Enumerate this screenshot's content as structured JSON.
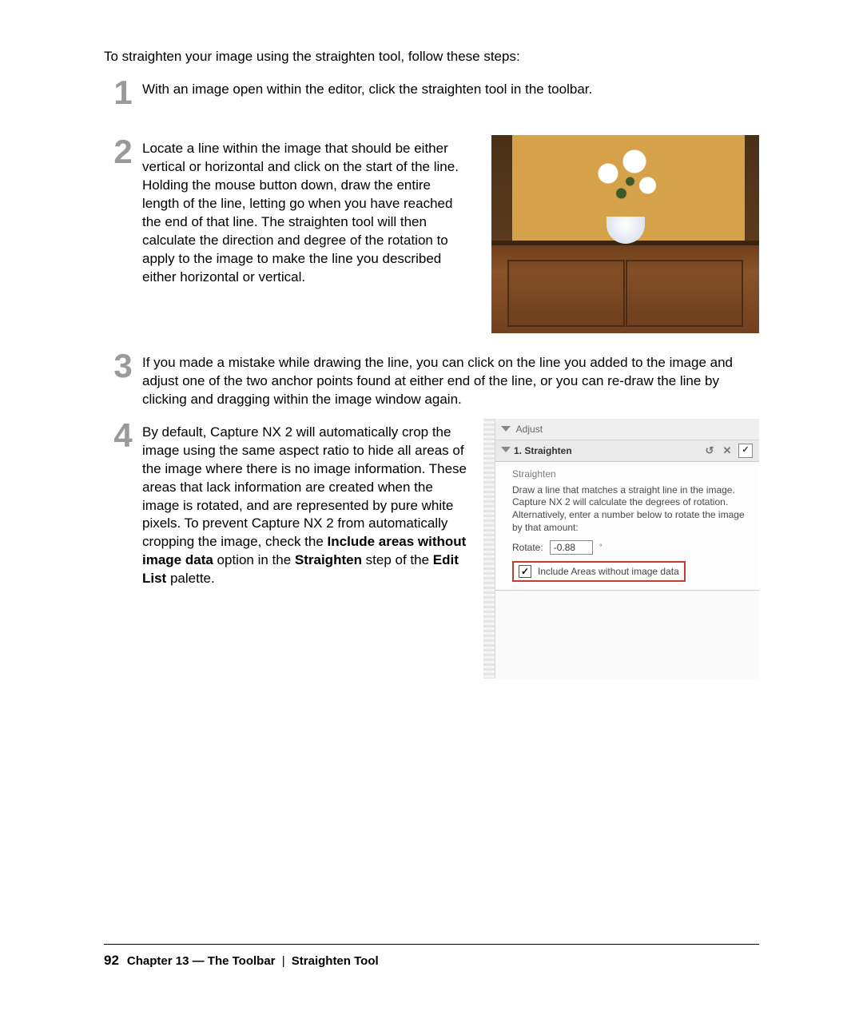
{
  "intro": "To straighten your image using the straighten tool, follow these steps:",
  "steps": {
    "s1": {
      "num": "1",
      "text": "With an image open within the editor, click the straighten tool in the toolbar."
    },
    "s2": {
      "num": "2",
      "text": "Locate a line within the image that should be either vertical or horizontal and click on the start of the line. Holding the mouse button down, draw the entire length of the line, letting go when you have reached the end of that line. The straighten tool will then calculate the direction and degree of the rotation to apply to the image to make the line you described either horizontal or vertical."
    },
    "s3": {
      "num": "3",
      "text": "If you made a mistake while drawing the line, you can click on the line you added to the image and adjust one of the two anchor points found at either end of the line, or you can re-draw the line by clicking and dragging within the image window again."
    },
    "s4": {
      "num": "4",
      "pre": "By default, Capture NX 2 will automatically crop the image using the same aspect ratio to hide all areas of the image where there is no image information. These areas that lack information are created when the image is rotated, and are represented by pure white pixels. To prevent Capture NX 2 from automatically cropping the image, check the ",
      "bold1": "Include areas without image data",
      "mid1": " option in the ",
      "bold2": "Straighten",
      "mid2": " step of the ",
      "bold3": "Edit List",
      "post": " palette."
    }
  },
  "palette": {
    "header": "Adjust",
    "section": "1. Straighten",
    "sub": "Straighten",
    "desc": "Draw a line that matches a straight line in the image.\nCapture NX 2 will calculate the degrees of rotation. Alternatively, enter a number below to rotate the image by that amount:",
    "rotate_label": "Rotate:",
    "rotate_value": "-0.88",
    "deg": "°",
    "include_label": "Include Areas without image data",
    "ok": "✓"
  },
  "footer": {
    "page": "92",
    "chapter": "Chapter 13",
    "dash": " — The Toolbar",
    "sep": "|",
    "tool": "Straighten Tool"
  }
}
